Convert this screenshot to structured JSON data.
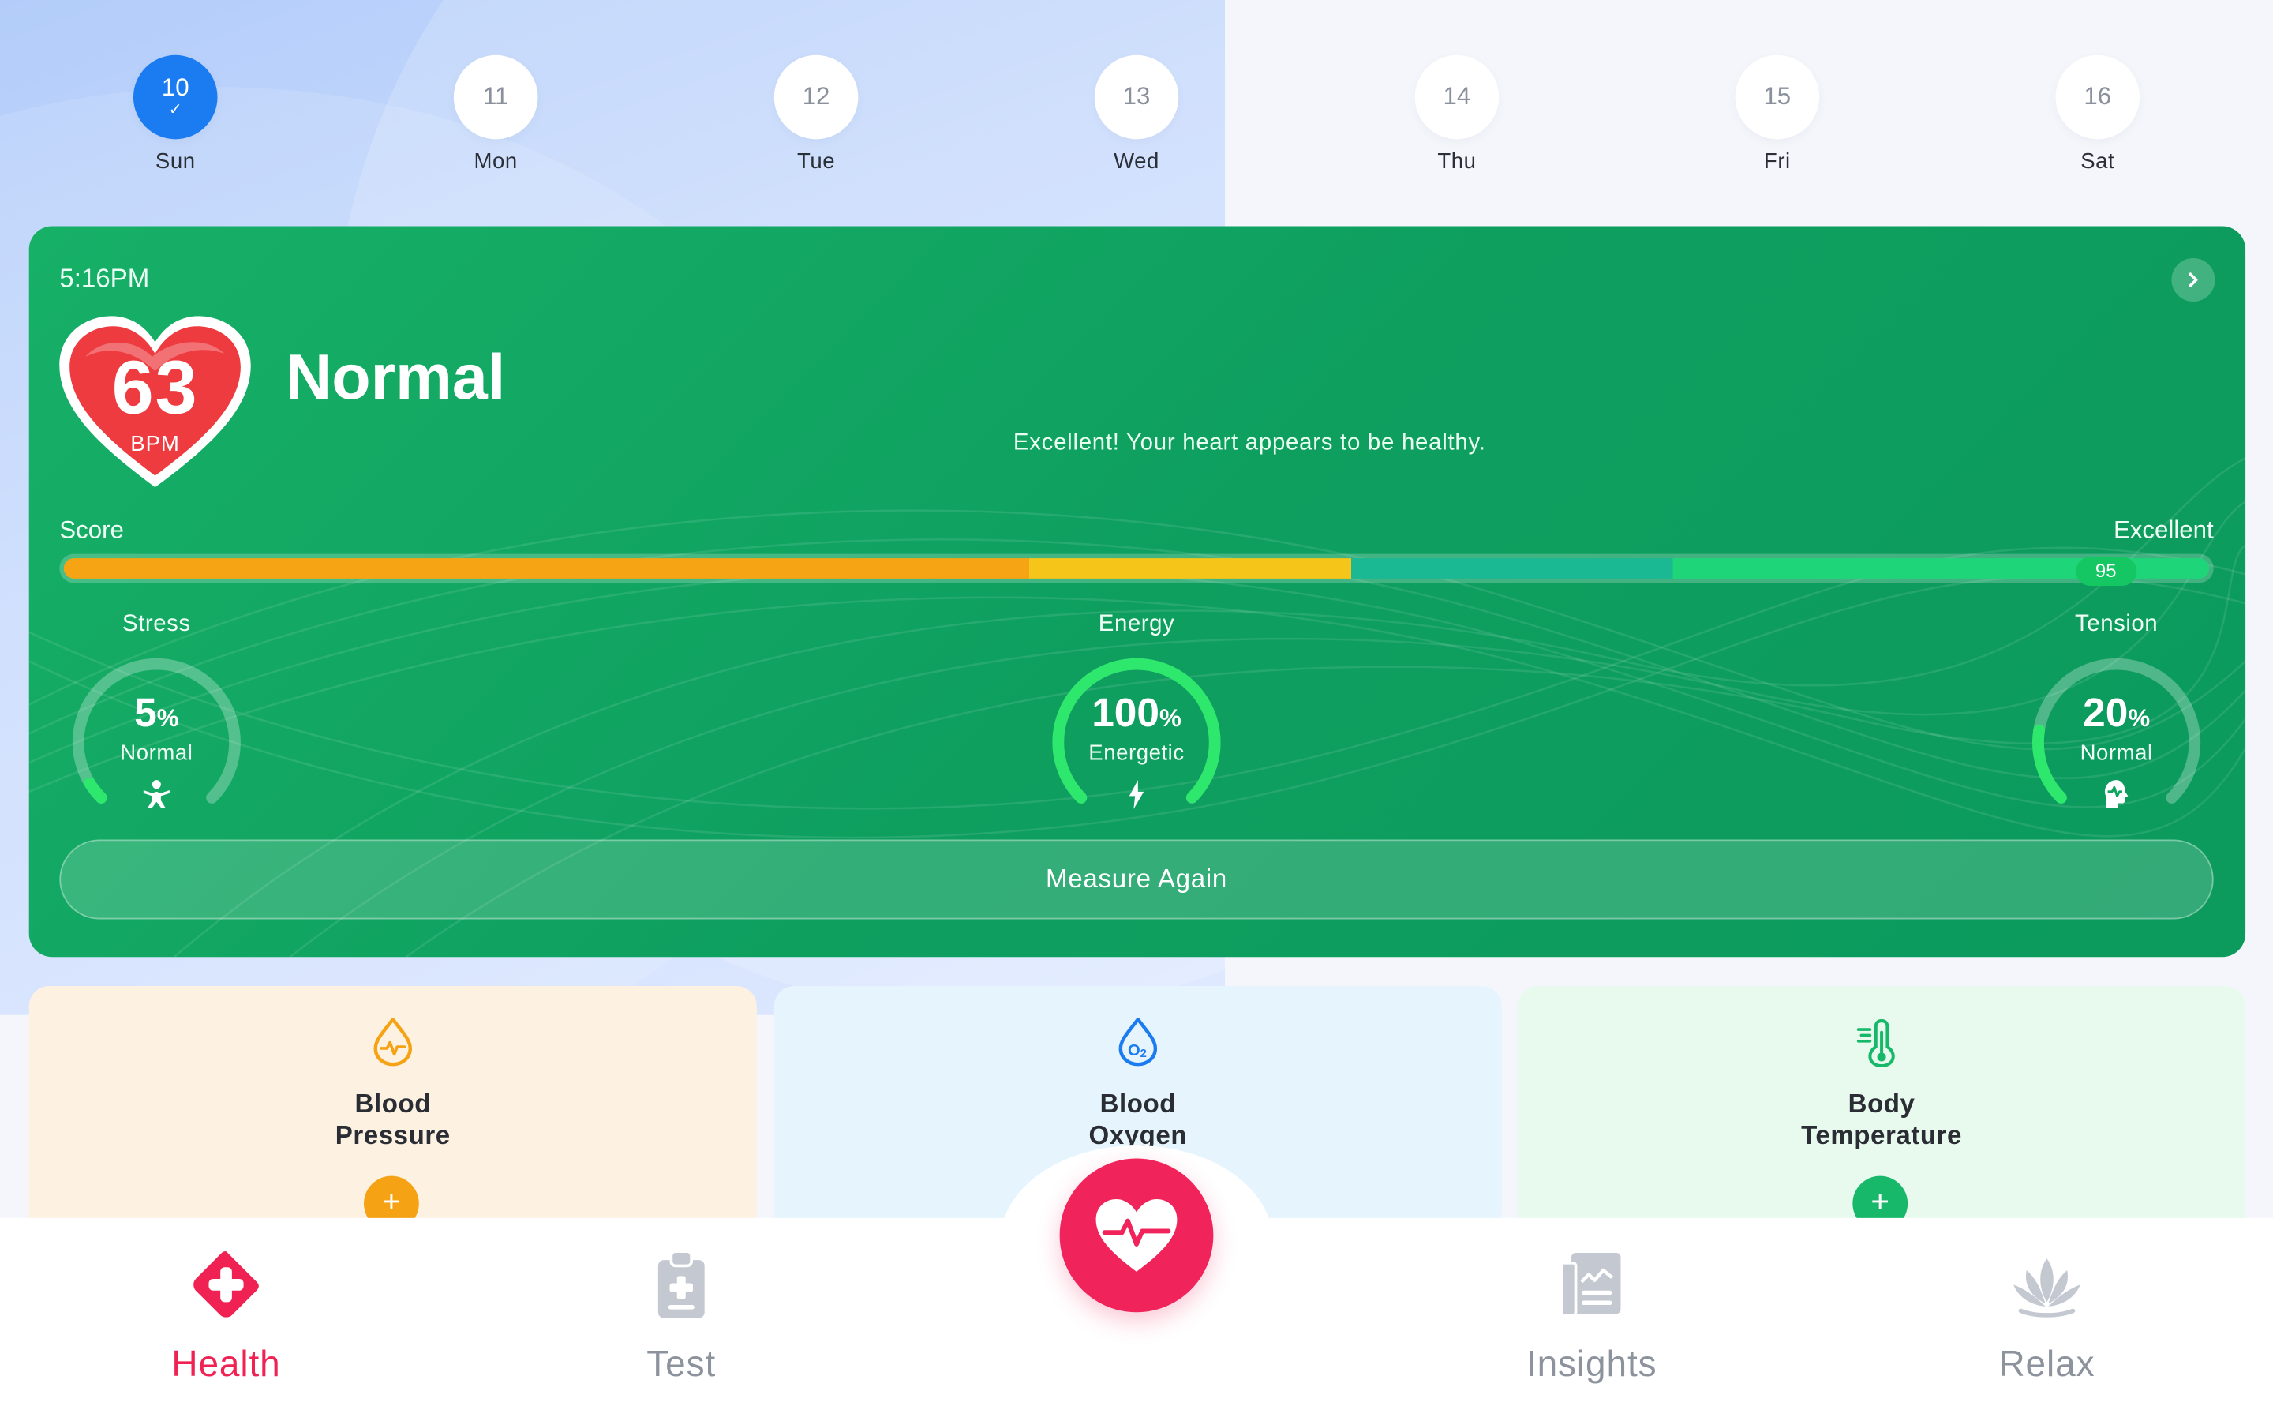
{
  "days": [
    {
      "num": "10",
      "label": "Sun",
      "active": true,
      "checked": true
    },
    {
      "num": "11",
      "label": "Mon",
      "active": false
    },
    {
      "num": "12",
      "label": "Tue",
      "active": false
    },
    {
      "num": "13",
      "label": "Wed",
      "active": false
    },
    {
      "num": "14",
      "label": "Thu",
      "active": false
    },
    {
      "num": "15",
      "label": "Fri",
      "active": false
    },
    {
      "num": "16",
      "label": "Sat",
      "active": false
    }
  ],
  "reading": {
    "time": "5:16PM",
    "bpm": "63",
    "bpm_unit": "BPM",
    "status": "Normal",
    "message": "Excellent! Your heart appears to be healthy."
  },
  "score": {
    "label": "Score",
    "rating": "Excellent",
    "value": "95",
    "value_fraction": 0.95
  },
  "gauges": [
    {
      "title": "Stress",
      "value": "5",
      "unit": "%",
      "sub": "Normal",
      "fraction": 0.05,
      "icon": "person-relax-icon"
    },
    {
      "title": "Energy",
      "value": "100",
      "unit": "%",
      "sub": "Energetic",
      "fraction": 1.0,
      "icon": "lightning-icon"
    },
    {
      "title": "Tension",
      "value": "20",
      "unit": "%",
      "sub": "Normal",
      "fraction": 0.2,
      "icon": "head-pulse-icon"
    }
  ],
  "measure_label": "Measure Again",
  "metrics": [
    {
      "title_line1": "Blood",
      "title_line2": "Pressure",
      "icon": "blood-drop-pulse-icon",
      "accent": "#f5a214",
      "bg": "#fdf2e2"
    },
    {
      "title_line1": "Blood",
      "title_line2": "Oxygen",
      "icon": "o2-drop-icon",
      "accent": "#1b7cf2",
      "bg": "#e6f5fd"
    },
    {
      "title_line1": "Body",
      "title_line2": "Temperature",
      "icon": "thermometer-icon",
      "accent": "#17b86a",
      "bg": "#e8faee"
    }
  ],
  "nav": {
    "items": [
      {
        "label": "Health",
        "icon": "medical-cross-icon",
        "active": true
      },
      {
        "label": "Test",
        "icon": "clipboard-icon",
        "active": false
      },
      {
        "label": "Insights",
        "icon": "report-icon",
        "active": false
      },
      {
        "label": "Relax",
        "icon": "lotus-icon",
        "active": false
      }
    ],
    "center_icon": "heart-pulse-icon"
  },
  "colors": {
    "accent_blue": "#1b7cf2",
    "card_green": "#0fa360",
    "health_red": "#ef2253",
    "center_pink": "#f0245b"
  }
}
